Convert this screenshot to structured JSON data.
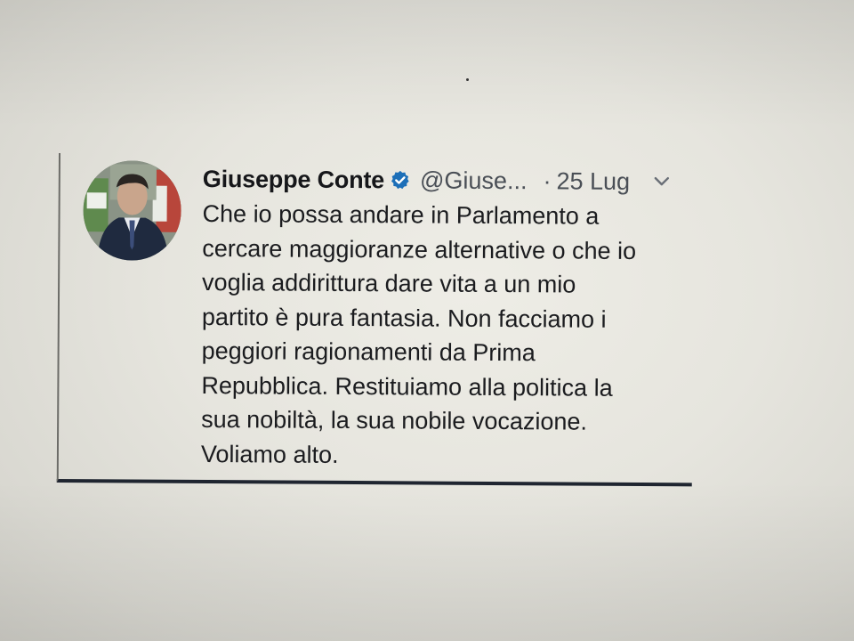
{
  "tweet": {
    "author": {
      "display_name": "Giuseppe Conte",
      "handle": "@Giuse...",
      "verified": true
    },
    "separator": "·",
    "date": "25 Lug",
    "text_lines": [
      "Che io possa andare in Parlamento a",
      "cercare maggioranze alternative o che io",
      "voglia addirittura dare vita a un mio",
      "partito è pura fantasia. Non facciamo i",
      "peggiori ragionamenti da Prima",
      "Repubblica. Restituiamo alla politica la",
      "sua nobiltà, la sua nobile vocazione.",
      "Voliamo alto."
    ],
    "icons": {
      "verified": "verified-badge-icon",
      "menu": "chevron-down-icon",
      "avatar": "avatar-photo"
    }
  },
  "colors": {
    "verified_blue": "#1d6fb8",
    "text": "#1b1c1f",
    "muted": "#4a4f56",
    "card_bottom_border": "#1f2530"
  }
}
